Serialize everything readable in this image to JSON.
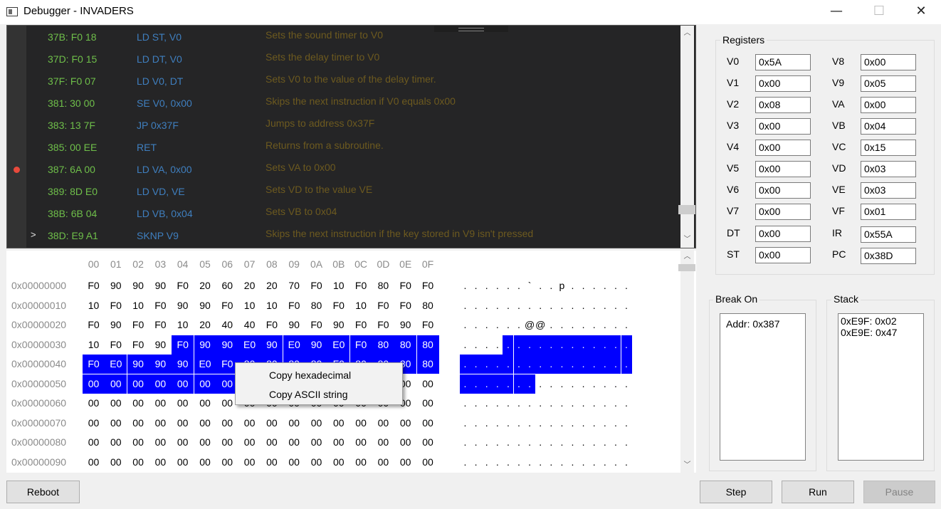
{
  "window": {
    "title": "Debugger - INVADERS",
    "minimize": "—",
    "maximize": "☐",
    "close": "✕"
  },
  "disassembly": {
    "rows": [
      {
        "marker": "",
        "addr": "37B: F0 18",
        "instr": "LD ST, V0",
        "desc": "Sets the sound timer to V0",
        "breakpoint": false
      },
      {
        "marker": "",
        "addr": "37D: F0 15",
        "instr": "LD DT, V0",
        "desc": "Sets the delay timer to V0",
        "breakpoint": false
      },
      {
        "marker": "",
        "addr": "37F: F0 07",
        "instr": "LD V0, DT",
        "desc": "Sets V0 to the value of the delay timer.",
        "breakpoint": false
      },
      {
        "marker": "",
        "addr": "381: 30 00",
        "instr": "SE V0, 0x00",
        "desc": "Skips the next instruction if V0 equals 0x00",
        "breakpoint": false
      },
      {
        "marker": "",
        "addr": "383: 13 7F",
        "instr": "JP 0x37F",
        "desc": "Jumps to address 0x37F",
        "breakpoint": false
      },
      {
        "marker": "",
        "addr": "385: 00 EE",
        "instr": "RET",
        "desc": "Returns from a subroutine.",
        "breakpoint": false
      },
      {
        "marker": "",
        "addr": "387: 6A 00",
        "instr": "LD VA, 0x00",
        "desc": "Sets VA to 0x00",
        "breakpoint": true
      },
      {
        "marker": "",
        "addr": "389: 8D E0",
        "instr": "LD VD, VE",
        "desc": "Sets VD to the value VE",
        "breakpoint": false
      },
      {
        "marker": "",
        "addr": "38B: 6B 04",
        "instr": "LD VB, 0x04",
        "desc": "Sets VB to 0x04",
        "breakpoint": false
      },
      {
        "marker": ">",
        "addr": "38D: E9 A1",
        "instr": "SKNP V9",
        "desc": "Skips the next instruction if the key stored in V9 isn't pressed",
        "breakpoint": false
      }
    ]
  },
  "hex": {
    "columns": [
      "00",
      "01",
      "02",
      "03",
      "04",
      "05",
      "06",
      "07",
      "08",
      "09",
      "0A",
      "0B",
      "0C",
      "0D",
      "0E",
      "0F"
    ],
    "rows": [
      {
        "addr": "0x00000000",
        "bytes": [
          "F0",
          "90",
          "90",
          "90",
          "F0",
          "20",
          "60",
          "20",
          "20",
          "70",
          "F0",
          "10",
          "F0",
          "80",
          "F0",
          "F0"
        ],
        "ascii": [
          ".",
          ".",
          ".",
          ".",
          ".",
          ".",
          "`",
          ".",
          ".",
          "p",
          ".",
          ".",
          ".",
          ".",
          ".",
          "."
        ]
      },
      {
        "addr": "0x00000010",
        "bytes": [
          "10",
          "F0",
          "10",
          "F0",
          "90",
          "90",
          "F0",
          "10",
          "10",
          "F0",
          "80",
          "F0",
          "10",
          "F0",
          "F0",
          "80"
        ],
        "ascii": [
          ".",
          ".",
          ".",
          ".",
          ".",
          ".",
          ".",
          ".",
          ".",
          ".",
          ".",
          ".",
          ".",
          ".",
          ".",
          "."
        ]
      },
      {
        "addr": "0x00000020",
        "bytes": [
          "F0",
          "90",
          "F0",
          "F0",
          "10",
          "20",
          "40",
          "40",
          "F0",
          "90",
          "F0",
          "90",
          "F0",
          "F0",
          "90",
          "F0"
        ],
        "ascii": [
          ".",
          ".",
          ".",
          ".",
          ".",
          ".",
          "@",
          "@",
          ".",
          ".",
          ".",
          ".",
          ".",
          ".",
          ".",
          "."
        ]
      },
      {
        "addr": "0x00000030",
        "bytes": [
          "10",
          "F0",
          "F0",
          "90",
          "F0",
          "90",
          "90",
          "E0",
          "90",
          "E0",
          "90",
          "E0",
          "F0",
          "80",
          "80",
          "80"
        ],
        "ascii": [
          ".",
          ".",
          ".",
          ".",
          ".",
          ".",
          ".",
          ".",
          ".",
          ".",
          ".",
          ".",
          ".",
          ".",
          ".",
          "."
        ]
      },
      {
        "addr": "0x00000040",
        "bytes": [
          "F0",
          "E0",
          "90",
          "90",
          "90",
          "E0",
          "F0",
          "80",
          "80",
          "80",
          "80",
          "F0",
          "80",
          "80",
          "80",
          "80"
        ],
        "ascii": [
          ".",
          ".",
          ".",
          ".",
          ".",
          ".",
          ".",
          ".",
          ".",
          ".",
          ".",
          ".",
          ".",
          ".",
          ".",
          "."
        ]
      },
      {
        "addr": "0x00000050",
        "bytes": [
          "00",
          "00",
          "00",
          "00",
          "00",
          "00",
          "00",
          "00",
          "00",
          "00",
          "00",
          "00",
          "00",
          "00",
          "00",
          "00"
        ],
        "ascii": [
          ".",
          ".",
          ".",
          ".",
          ".",
          ".",
          ".",
          ".",
          ".",
          ".",
          ".",
          ".",
          ".",
          ".",
          ".",
          "."
        ]
      },
      {
        "addr": "0x00000060",
        "bytes": [
          "00",
          "00",
          "00",
          "00",
          "00",
          "00",
          "00",
          "00",
          "00",
          "00",
          "00",
          "00",
          "00",
          "00",
          "00",
          "00"
        ],
        "ascii": [
          ".",
          ".",
          ".",
          ".",
          ".",
          ".",
          ".",
          ".",
          ".",
          ".",
          ".",
          ".",
          ".",
          ".",
          ".",
          "."
        ]
      },
      {
        "addr": "0x00000070",
        "bytes": [
          "00",
          "00",
          "00",
          "00",
          "00",
          "00",
          "00",
          "00",
          "00",
          "00",
          "00",
          "00",
          "00",
          "00",
          "00",
          "00"
        ],
        "ascii": [
          ".",
          ".",
          ".",
          ".",
          ".",
          ".",
          ".",
          ".",
          ".",
          ".",
          ".",
          ".",
          ".",
          ".",
          ".",
          "."
        ]
      },
      {
        "addr": "0x00000080",
        "bytes": [
          "00",
          "00",
          "00",
          "00",
          "00",
          "00",
          "00",
          "00",
          "00",
          "00",
          "00",
          "00",
          "00",
          "00",
          "00",
          "00"
        ],
        "ascii": [
          ".",
          ".",
          ".",
          ".",
          ".",
          ".",
          ".",
          ".",
          ".",
          ".",
          ".",
          ".",
          ".",
          ".",
          ".",
          "."
        ]
      },
      {
        "addr": "0x00000090",
        "bytes": [
          "00",
          "00",
          "00",
          "00",
          "00",
          "00",
          "00",
          "00",
          "00",
          "00",
          "00",
          "00",
          "00",
          "00",
          "00",
          "00"
        ],
        "ascii": [
          ".",
          ".",
          ".",
          ".",
          ".",
          ".",
          ".",
          ".",
          ".",
          ".",
          ".",
          ".",
          ".",
          ".",
          ".",
          "."
        ]
      }
    ],
    "selection": {
      "start": 52,
      "end": 86
    }
  },
  "context_menu": {
    "items": [
      "Copy hexadecimal",
      "Copy ASCII string"
    ]
  },
  "registers": {
    "title": "Registers",
    "left": [
      {
        "name": "V0",
        "value": "0x5A"
      },
      {
        "name": "V1",
        "value": "0x00"
      },
      {
        "name": "V2",
        "value": "0x08"
      },
      {
        "name": "V3",
        "value": "0x00"
      },
      {
        "name": "V4",
        "value": "0x00"
      },
      {
        "name": "V5",
        "value": "0x00"
      },
      {
        "name": "V6",
        "value": "0x00"
      },
      {
        "name": "V7",
        "value": "0x00"
      },
      {
        "name": "DT",
        "value": "0x00"
      },
      {
        "name": "ST",
        "value": "0x00"
      }
    ],
    "right": [
      {
        "name": "V8",
        "value": "0x00"
      },
      {
        "name": "V9",
        "value": "0x05"
      },
      {
        "name": "VA",
        "value": "0x00"
      },
      {
        "name": "VB",
        "value": "0x04"
      },
      {
        "name": "VC",
        "value": "0x15"
      },
      {
        "name": "VD",
        "value": "0x03"
      },
      {
        "name": "VE",
        "value": "0x03"
      },
      {
        "name": "VF",
        "value": "0x01"
      },
      {
        "name": "IR",
        "value": "0x55A"
      },
      {
        "name": "PC",
        "value": "0x38D"
      }
    ]
  },
  "break_on": {
    "title": "Break On",
    "items": [
      "Addr: 0x387"
    ]
  },
  "stack": {
    "title": "Stack",
    "items": [
      "0xE9F: 0x02",
      "0xE9E: 0x47"
    ]
  },
  "buttons": {
    "reboot": "Reboot",
    "step": "Step",
    "run": "Run",
    "pause": "Pause"
  },
  "colors": {
    "selection": "#0000ff",
    "breakpoint": "#e84a3c",
    "address": "#6fbf4a",
    "instruction": "#3f7fbf",
    "description": "#6d5a1f"
  }
}
